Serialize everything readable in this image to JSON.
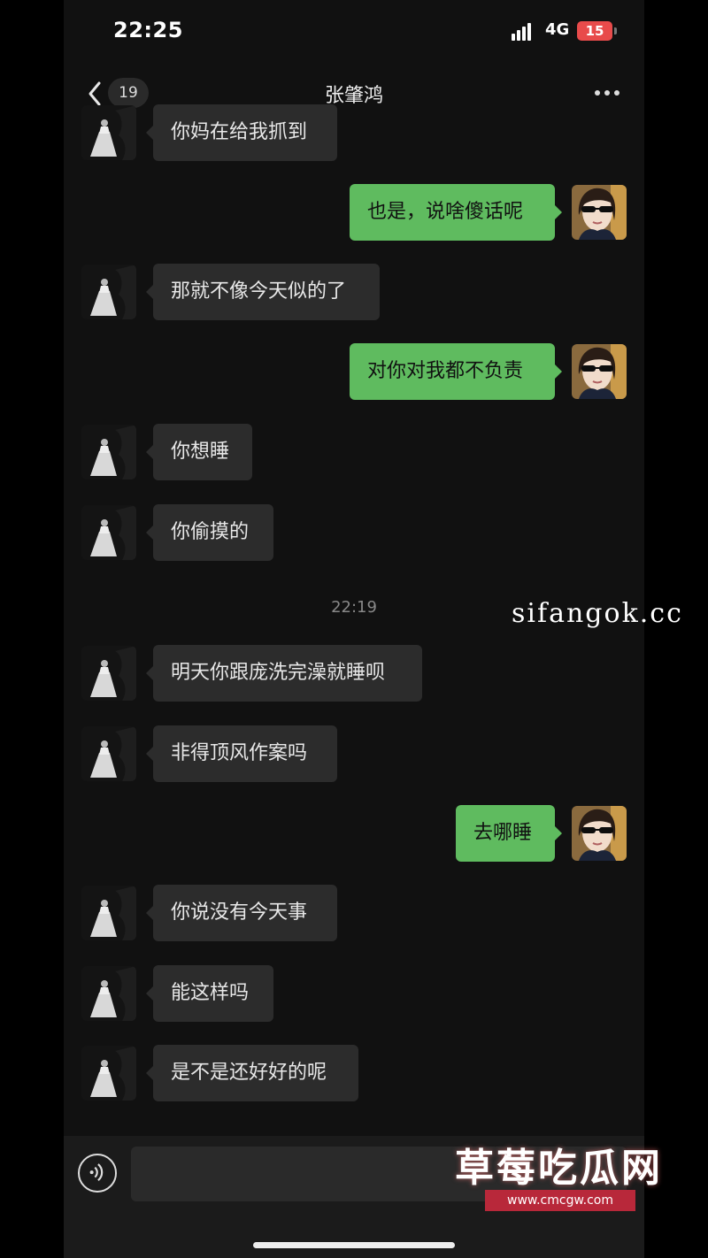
{
  "status_bar": {
    "time": "22:25",
    "network": "4G",
    "battery": "15"
  },
  "header": {
    "back_count": "19",
    "title": "张肇鸿"
  },
  "messages": [
    {
      "side": "in",
      "text": "你妈在给我抓到"
    },
    {
      "side": "out",
      "text": "也是，说啥傻话呢"
    },
    {
      "side": "in",
      "text": "那就不像今天似的了"
    },
    {
      "side": "out",
      "text": "对你对我都不负责"
    },
    {
      "side": "in",
      "text": "你想睡"
    },
    {
      "side": "in",
      "text": "你偷摸的"
    },
    {
      "side": "in",
      "text": "明天你跟庞洗完澡就睡呗"
    },
    {
      "side": "in",
      "text": "非得顶风作案吗"
    },
    {
      "side": "out",
      "text": "去哪睡"
    },
    {
      "side": "in",
      "text": "你说没有今天事"
    },
    {
      "side": "in",
      "text": "能这样吗"
    },
    {
      "side": "in",
      "text": "是不是还好好的呢"
    }
  ],
  "timestamp": "22:19",
  "input": {
    "value": "",
    "placeholder": ""
  },
  "watermarks": {
    "site_text": "sifangok.cc",
    "brand": "草莓吃瓜网",
    "url": "www.cmcgw.com"
  },
  "colors": {
    "background": "#111111",
    "incoming_bubble": "#2c2c2c",
    "outgoing_bubble": "#5fbb5f",
    "battery_low": "#e84b4b"
  }
}
